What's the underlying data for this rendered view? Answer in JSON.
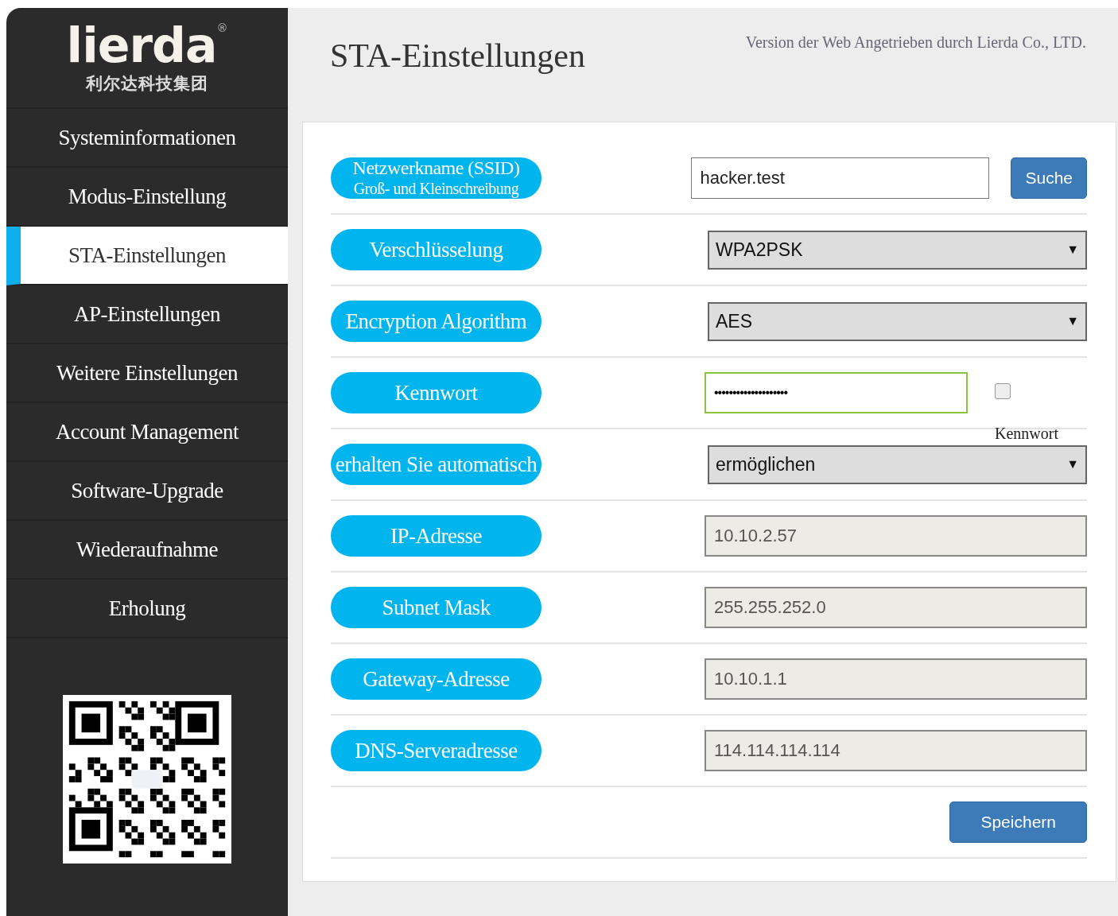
{
  "logo": {
    "brand": "lierda",
    "mark": "®",
    "subtitle": "利尔达科技集团"
  },
  "sidebar": {
    "items": [
      {
        "label": "Systeminformationen",
        "selected": false
      },
      {
        "label": "Modus-Einstellung",
        "selected": false
      },
      {
        "label": "STA-Einstellungen",
        "selected": true
      },
      {
        "label": "AP-Einstellungen",
        "selected": false
      },
      {
        "label": "Weitere Einstellungen",
        "selected": false
      },
      {
        "label": "Account Management",
        "selected": false
      },
      {
        "label": "Software-Upgrade",
        "selected": false
      },
      {
        "label": "Wiederaufnahme",
        "selected": false
      },
      {
        "label": "Erholung",
        "selected": false
      }
    ]
  },
  "header": {
    "title": "STA-Einstellungen",
    "version": "Version der Web Angetrieben durch Lierda Co., LTD."
  },
  "form": {
    "rows": [
      {
        "kind": "text",
        "label": "Netzwerkname (SSID)",
        "sublabel": "Groß- und Kleinschreibung",
        "value": "hacker.test",
        "button": "Suche"
      },
      {
        "kind": "select",
        "label": "Verschlüsselung",
        "value": "WPA2PSK",
        "arrow": "▼"
      },
      {
        "kind": "select",
        "label": "Encryption Algorithm",
        "value": "AES",
        "arrow": "▼"
      },
      {
        "kind": "password",
        "label": "Kennwort",
        "value": "••••••••••••••••••••",
        "checkbox": {
          "label": "Kennwort",
          "checked": false
        }
      },
      {
        "kind": "select",
        "label": "erhalten Sie automatisch",
        "value": "ermöglichen",
        "arrow": "▼"
      },
      {
        "kind": "readonly",
        "label": "IP-Adresse",
        "value": "10.10.2.57"
      },
      {
        "kind": "readonly",
        "label": "Subnet Mask",
        "value": "255.255.252.0"
      },
      {
        "kind": "readonly",
        "label": "Gateway-Adresse",
        "value": "10.10.1.1"
      },
      {
        "kind": "readonly",
        "label": "DNS-Serveradresse",
        "value": "114.114.114.114"
      }
    ],
    "save": "Speichern"
  }
}
